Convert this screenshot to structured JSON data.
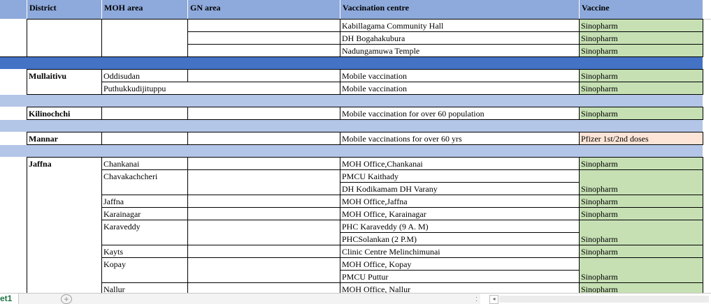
{
  "headers": [
    "District",
    "MOH area",
    "GN area",
    "Vaccination centre",
    "Vaccine"
  ],
  "rows": [
    {
      "district": "",
      "moh": "",
      "gn": "",
      "centre": "Kabillagama Community Hall",
      "vaccine": "Sinopharm"
    },
    {
      "district": "",
      "moh": "",
      "gn": "",
      "centre": "DH Bogahakubura",
      "vaccine": "Sinopharm"
    },
    {
      "district": "",
      "moh": "",
      "gn": "",
      "centre": "Nadungamuwa Temple",
      "vaccine": "Sinopharm"
    },
    {
      "district": "Mullaitivu",
      "moh": "Oddisudan",
      "gn": "",
      "centre": "Mobile vaccination",
      "vaccine": "Sinopharm"
    },
    {
      "district": "",
      "moh": "Puthukkudijituppu",
      "gn": "",
      "centre": "Mobile vaccination",
      "vaccine": "Sinopharm"
    },
    {
      "district": "Kilinochchi",
      "moh": "",
      "gn": "",
      "centre": "Mobile vaccination for over 60 population",
      "vaccine": "Sinopharm"
    },
    {
      "district": "Mannar",
      "moh": "",
      "gn": "",
      "centre": "Mobile vaccinations for over 60 yrs",
      "vaccine": "Pfizer 1st/2nd doses"
    },
    {
      "district": "Jaffna",
      "moh": "Chankanai",
      "gn": "",
      "centre": "MOH Office,Chankanai",
      "vaccine": "Sinopharm"
    },
    {
      "district": "",
      "moh": "Chavakachcheri",
      "gn": "",
      "centre": "PMCU Kaithady",
      "vaccine": ""
    },
    {
      "district": "",
      "moh": "",
      "gn": "",
      "centre": "DH Kodikamam DH Varany",
      "vaccine": "Sinopharm"
    },
    {
      "district": "",
      "moh": "Jaffna",
      "gn": "",
      "centre": "MOH Office,Jaffna",
      "vaccine": "Sinopharm"
    },
    {
      "district": "",
      "moh": "Karainagar",
      "gn": "",
      "centre": "MOH Office, Karainagar",
      "vaccine": "Sinopharm"
    },
    {
      "district": "",
      "moh": "Karaveddy",
      "gn": "",
      "centre": "PHC Karaveddy (9 A. M)",
      "vaccine": ""
    },
    {
      "district": "",
      "moh": "",
      "gn": "",
      "centre": "PHCSolankan (2 P.M)",
      "vaccine": "Sinopharm"
    },
    {
      "district": "",
      "moh": "Kayts",
      "gn": "",
      "centre": "Clinic Centre Melinchimunai",
      "vaccine": "Sinopharm"
    },
    {
      "district": "",
      "moh": "Kopay",
      "gn": "",
      "centre": "MOH Office, Kopay",
      "vaccine": ""
    },
    {
      "district": "",
      "moh": "",
      "gn": "",
      "centre": "PMCU Puttur",
      "vaccine": "Sinopharm"
    },
    {
      "district": "",
      "moh": "Nallur",
      "gn": "",
      "centre": "MOH Office, Nallur",
      "vaccine": "Sinopharm"
    }
  ],
  "sheet_tab": "et1",
  "add_sheet_symbol": "+",
  "tab_split_symbol": ":",
  "scroll_left_symbol": "◂",
  "colors": {
    "header": "#8ea9db",
    "band_dark": "#4472c4",
    "band_light": "#b4c6e7",
    "vaccine_green": "#c6e0b4",
    "vaccine_peach": "#fce4d6",
    "sheet_tab_text": "#217346"
  }
}
